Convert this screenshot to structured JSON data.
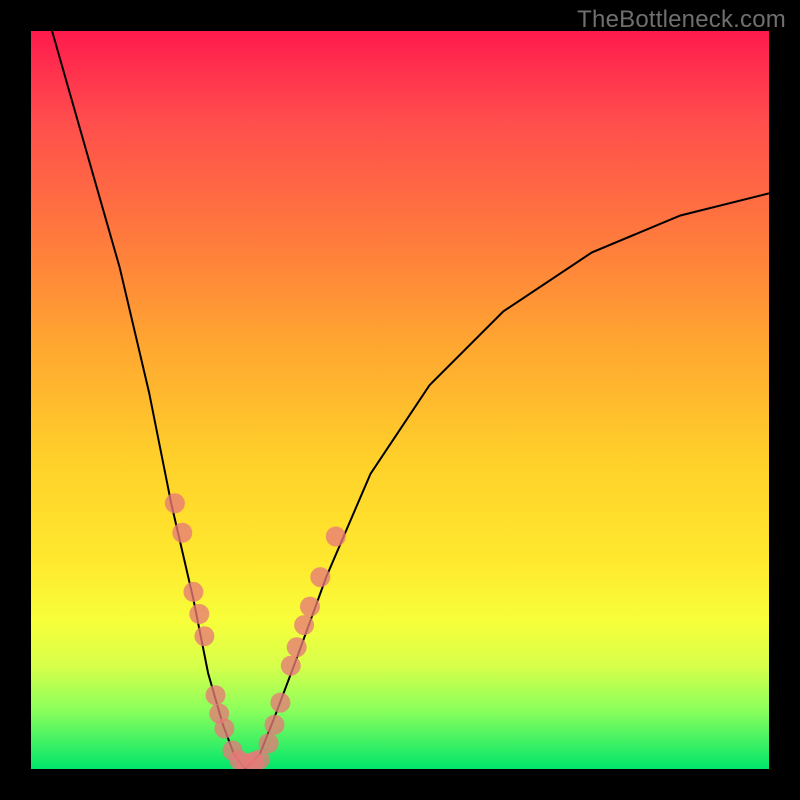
{
  "watermark": "TheBottleneck.com",
  "colors": {
    "frame": "#000000",
    "gradient_top": "#ff1a4d",
    "gradient_bottom": "#00e56b",
    "curve": "#000000",
    "marker": "#e77a78"
  },
  "chart_data": {
    "type": "line",
    "title": "",
    "xlabel": "",
    "ylabel": "",
    "xlim": [
      0,
      100
    ],
    "ylim": [
      0,
      100
    ],
    "series": [
      {
        "name": "bottleneck-curve",
        "x": [
          0,
          4,
          8,
          12,
          16,
          19,
          22,
          24,
          26,
          27.5,
          29,
          31,
          33,
          36,
          40,
          46,
          54,
          64,
          76,
          88,
          100
        ],
        "y": [
          110,
          96,
          82,
          68,
          51,
          36,
          23,
          13,
          6,
          2,
          0,
          2,
          7,
          15,
          26,
          40,
          52,
          62,
          70,
          75,
          78
        ]
      }
    ],
    "markers": {
      "name": "highlighted-points",
      "shape": "rounded-square",
      "points": [
        {
          "x": 19.5,
          "y": 36
        },
        {
          "x": 20.5,
          "y": 32
        },
        {
          "x": 22.0,
          "y": 24
        },
        {
          "x": 22.8,
          "y": 21
        },
        {
          "x": 23.5,
          "y": 18
        },
        {
          "x": 25.0,
          "y": 10
        },
        {
          "x": 25.5,
          "y": 7.5
        },
        {
          "x": 26.2,
          "y": 5.5
        },
        {
          "x": 27.3,
          "y": 2.5
        },
        {
          "x": 28.2,
          "y": 1.2
        },
        {
          "x": 29.0,
          "y": 0.8
        },
        {
          "x": 30.2,
          "y": 1.0
        },
        {
          "x": 31.0,
          "y": 1.3
        },
        {
          "x": 32.2,
          "y": 3.5
        },
        {
          "x": 33.0,
          "y": 6
        },
        {
          "x": 33.8,
          "y": 9
        },
        {
          "x": 35.2,
          "y": 14
        },
        {
          "x": 36.0,
          "y": 16.5
        },
        {
          "x": 37.0,
          "y": 19.5
        },
        {
          "x": 37.8,
          "y": 22
        },
        {
          "x": 39.2,
          "y": 26
        },
        {
          "x": 41.3,
          "y": 31.5
        }
      ]
    }
  }
}
